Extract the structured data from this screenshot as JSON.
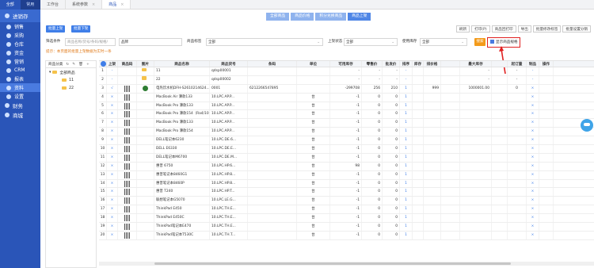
{
  "sidebar": {
    "tabs": [
      "全部",
      "常用"
    ],
    "group": "进销存",
    "items": [
      "销售",
      "采购",
      "仓库",
      "资金",
      "营销",
      "CRM",
      "报表",
      "资料",
      "设置"
    ],
    "subs": [
      "财务",
      "商城"
    ]
  },
  "topbar": {
    "tabs": [
      "工作台",
      "系统参数",
      "商品"
    ]
  },
  "subtabs": [
    "全部商品",
    "商品价格",
    "积分兑换商品",
    "商品上架"
  ],
  "toolbar": {
    "left": [
      "批量上架",
      "批量下架"
    ],
    "right": [
      "刷新",
      "打印(P)",
      "商品回打印",
      "导出",
      "批量修改标签",
      "批量设置分销"
    ]
  },
  "filters": {
    "search_label": "筛选条件",
    "search_placeholder": "商品名称/货号/条码/规格/",
    "value1": "品牌",
    "tag_label": "商品标签",
    "tag_value": "全部",
    "shelf_label": "上架状态",
    "shelf_value": "全部",
    "stock_label": "使用库存",
    "stock_value": "全部",
    "search_btn": "搜索",
    "show_spec": "显示商品规格"
  },
  "notice": "提示：本页面的批量上架数据为实时一条",
  "tree": {
    "header": "商品分类",
    "root": "全部商品",
    "children": [
      "11",
      "22"
    ]
  },
  "table": {
    "headers": [
      "",
      "上架",
      "商品码",
      "图片",
      "商品名称",
      "商品货号",
      "条码",
      "单位",
      "可用库存",
      "零售价",
      "批发价",
      "排序",
      "库存",
      "排价格",
      "",
      "最大库存",
      "",
      "起订量",
      "制品",
      "操作"
    ],
    "rows": [
      {
        "n": "1",
        "up": "-",
        "name": "11",
        "code": "qdsp00001",
        "bar": "",
        "unit": "",
        "stock": "-",
        "retail": "-",
        "whole": "-",
        "sort": "-",
        "inv": "",
        "price": "-",
        "max": "-",
        "moq": "-"
      },
      {
        "n": "2",
        "up": "-",
        "name": "22",
        "code": "qdsp00002",
        "bar": "",
        "unit": "",
        "stock": "-",
        "retail": "-",
        "whole": "-",
        "sort": "-",
        "inv": "",
        "price": "-",
        "max": "-",
        "moq": "-"
      },
      {
        "n": "3",
        "up": "√",
        "name": "电热饮水机DFH-S2610214624...",
        "code": "0001",
        "bar": "6212266547895",
        "unit": "",
        "stock": "-299708",
        "retail": "256",
        "whole": "210",
        "sort": "1",
        "inv": "999",
        "price": "1000001.00",
        "max": "0",
        "moq": "×"
      },
      {
        "n": "4",
        "up": "×",
        "name": "MacBook Air 薄款133",
        "code": "10.LPC.AP.P...",
        "bar": "",
        "unit": "台",
        "stock": "-1",
        "retail": "0",
        "whole": "0",
        "sort": "1",
        "inv": "",
        "price": "",
        "max": "",
        "moq": "×"
      },
      {
        "n": "5",
        "up": "×",
        "name": "MacBook Pro 薄款133",
        "code": "10.LPC.AP.P...",
        "bar": "",
        "unit": "台",
        "stock": "-1",
        "retail": "0",
        "whole": "0",
        "sort": "1",
        "inv": "",
        "price": "",
        "max": "",
        "moq": "×"
      },
      {
        "n": "6",
        "up": "×",
        "name": "MacBook Pro 薄款154（Ra4/10...",
        "code": "10.LPC.AP.P...",
        "bar": "",
        "unit": "台",
        "stock": "-1",
        "retail": "0",
        "whole": "0",
        "sort": "1",
        "inv": "",
        "price": "",
        "max": "",
        "moq": "×"
      },
      {
        "n": "7",
        "up": "×",
        "name": "MacBook Pro 薄款133",
        "code": "10.LPC.AP.P...",
        "bar": "",
        "unit": "台",
        "stock": "-1",
        "retail": "0",
        "whole": "0",
        "sort": "1",
        "inv": "",
        "price": "",
        "max": "",
        "moq": "×"
      },
      {
        "n": "8",
        "up": "×",
        "name": "MacBook Pro 薄款154",
        "code": "10.LPC.AP.P...",
        "bar": "",
        "unit": "台",
        "stock": "-1",
        "retail": "0",
        "whole": "0",
        "sort": "1",
        "inv": "",
        "price": "",
        "max": "",
        "moq": "×"
      },
      {
        "n": "9",
        "up": "×",
        "name": "DELL笔记本6230",
        "code": "10.LPC.DE.6...",
        "bar": "",
        "unit": "台",
        "stock": "-1",
        "retail": "0",
        "whole": "0",
        "sort": "1",
        "inv": "",
        "price": "",
        "max": "",
        "moq": "×"
      },
      {
        "n": "10",
        "up": "×",
        "name": "DELL E6330",
        "code": "10.LPC.DE.E...",
        "bar": "",
        "unit": "台",
        "stock": "-1",
        "retail": "0",
        "whole": "0",
        "sort": "1",
        "inv": "",
        "price": "",
        "max": "",
        "moq": "×"
      },
      {
        "n": "11",
        "up": "×",
        "name": "DELL笔记本M6700",
        "code": "10.LPC.DE.M...",
        "bar": "",
        "unit": "台",
        "stock": "-1",
        "retail": "0",
        "whole": "0",
        "sort": "1",
        "inv": "",
        "price": "",
        "max": "",
        "moq": "×"
      },
      {
        "n": "12",
        "up": "×",
        "name": "惠普 6750",
        "code": "10.LPC.HP.6...",
        "bar": "",
        "unit": "台",
        "stock": "98",
        "retail": "0",
        "whole": "0",
        "sort": "1",
        "inv": "",
        "price": "",
        "max": "",
        "moq": "×"
      },
      {
        "n": "13",
        "up": "×",
        "name": "惠普笔记本8460G1",
        "code": "10.LPC.HP.8...",
        "bar": "",
        "unit": "台",
        "stock": "-1",
        "retail": "0",
        "whole": "0",
        "sort": "1",
        "inv": "",
        "price": "",
        "max": "",
        "moq": "×"
      },
      {
        "n": "14",
        "up": "×",
        "name": "惠普笔记本8460P",
        "code": "10.LPC.HP.8...",
        "bar": "",
        "unit": "台",
        "stock": "-1",
        "retail": "0",
        "whole": "0",
        "sort": "1",
        "inv": "",
        "price": "",
        "max": "",
        "moq": "×"
      },
      {
        "n": "15",
        "up": "×",
        "name": "惠普 T240",
        "code": "10.LPC.HP.T...",
        "bar": "",
        "unit": "台",
        "stock": "-1",
        "retail": "0",
        "whole": "0",
        "sort": "1",
        "inv": "",
        "price": "",
        "max": "",
        "moq": "×"
      },
      {
        "n": "16",
        "up": "×",
        "name": "联想笔记本G5070",
        "code": "10.LPC.LE.G...",
        "bar": "",
        "unit": "台",
        "stock": "-1",
        "retail": "0",
        "whole": "0",
        "sort": "1",
        "inv": "",
        "price": "",
        "max": "",
        "moq": "×"
      },
      {
        "n": "17",
        "up": "×",
        "name": "ThinkPad E450",
        "code": "10.LPC.TH.E...",
        "bar": "",
        "unit": "台",
        "stock": "-1",
        "retail": "0",
        "whole": "0",
        "sort": "1",
        "inv": "",
        "price": "",
        "max": "",
        "moq": "×"
      },
      {
        "n": "18",
        "up": "×",
        "name": "ThinkPad E450C",
        "code": "10.LPC.TH.E...",
        "bar": "",
        "unit": "台",
        "stock": "-1",
        "retail": "0",
        "whole": "0",
        "sort": "1",
        "inv": "",
        "price": "",
        "max": "",
        "moq": "×"
      },
      {
        "n": "19",
        "up": "×",
        "name": "ThinkPad笔记本E470",
        "code": "10.LPC.TH.E...",
        "bar": "",
        "unit": "台",
        "stock": "-1",
        "retail": "0",
        "whole": "0",
        "sort": "1",
        "inv": "",
        "price": "",
        "max": "",
        "moq": "×"
      },
      {
        "n": "20",
        "up": "×",
        "name": "ThinkPad笔记本T530C",
        "code": "10.LPC.TH.T...",
        "bar": "",
        "unit": "台",
        "stock": "-1",
        "retail": "0",
        "whole": "0",
        "sort": "1",
        "inv": "",
        "price": "",
        "max": "",
        "moq": "×"
      }
    ]
  }
}
